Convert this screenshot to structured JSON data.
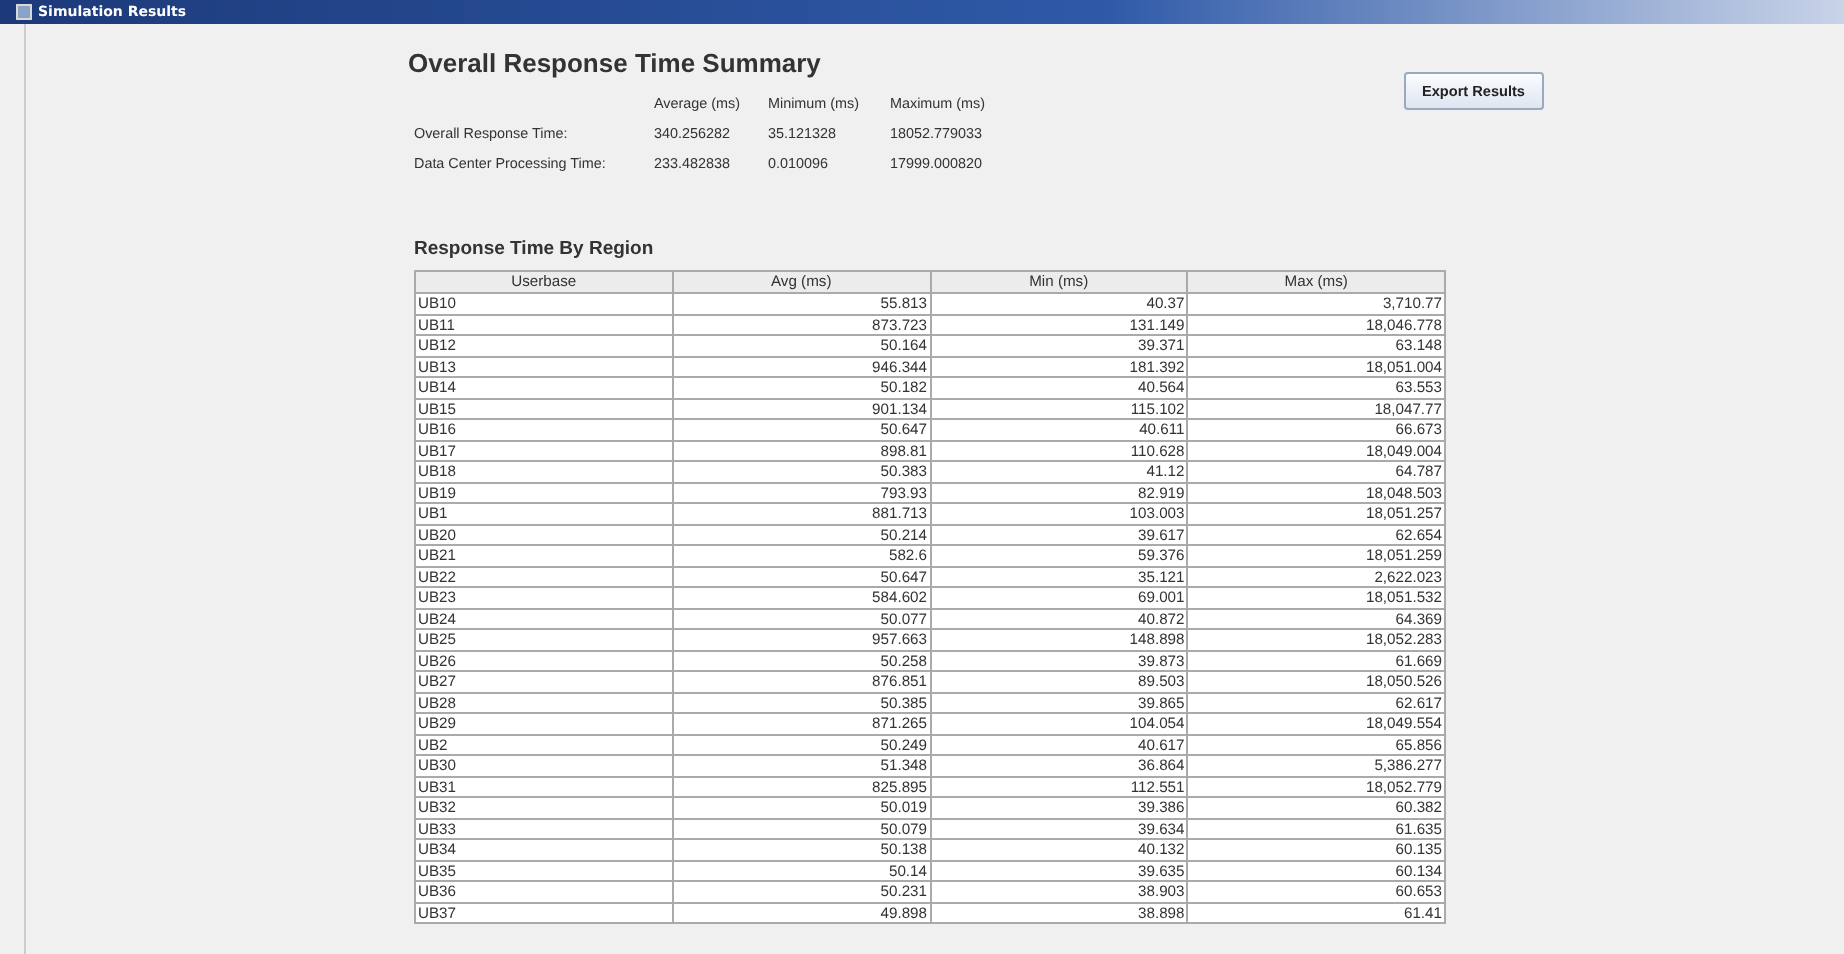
{
  "window": {
    "title": "Simulation Results"
  },
  "summary": {
    "title": "Overall Response Time Summary",
    "columns": [
      "Average (ms)",
      "Minimum (ms)",
      "Maximum (ms)"
    ],
    "rows": [
      {
        "label": "Overall Response Time:",
        "values": [
          "340.256282",
          "35.121328",
          "18052.779033"
        ]
      },
      {
        "label": "Data Center Processing Time:",
        "values": [
          "233.482838",
          "0.010096",
          "17999.000820"
        ]
      }
    ]
  },
  "export_button": "Export Results",
  "region": {
    "title": "Response Time By Region",
    "columns": [
      "Userbase",
      "Avg (ms)",
      "Min (ms)",
      "Max (ms)"
    ],
    "rows": [
      [
        "UB10",
        "55.813",
        "40.37",
        "3,710.77"
      ],
      [
        "UB11",
        "873.723",
        "131.149",
        "18,046.778"
      ],
      [
        "UB12",
        "50.164",
        "39.371",
        "63.148"
      ],
      [
        "UB13",
        "946.344",
        "181.392",
        "18,051.004"
      ],
      [
        "UB14",
        "50.182",
        "40.564",
        "63.553"
      ],
      [
        "UB15",
        "901.134",
        "115.102",
        "18,047.77"
      ],
      [
        "UB16",
        "50.647",
        "40.611",
        "66.673"
      ],
      [
        "UB17",
        "898.81",
        "110.628",
        "18,049.004"
      ],
      [
        "UB18",
        "50.383",
        "41.12",
        "64.787"
      ],
      [
        "UB19",
        "793.93",
        "82.919",
        "18,048.503"
      ],
      [
        "UB1",
        "881.713",
        "103.003",
        "18,051.257"
      ],
      [
        "UB20",
        "50.214",
        "39.617",
        "62.654"
      ],
      [
        "UB21",
        "582.6",
        "59.376",
        "18,051.259"
      ],
      [
        "UB22",
        "50.647",
        "35.121",
        "2,622.023"
      ],
      [
        "UB23",
        "584.602",
        "69.001",
        "18,051.532"
      ],
      [
        "UB24",
        "50.077",
        "40.872",
        "64.369"
      ],
      [
        "UB25",
        "957.663",
        "148.898",
        "18,052.283"
      ],
      [
        "UB26",
        "50.258",
        "39.873",
        "61.669"
      ],
      [
        "UB27",
        "876.851",
        "89.503",
        "18,050.526"
      ],
      [
        "UB28",
        "50.385",
        "39.865",
        "62.617"
      ],
      [
        "UB29",
        "871.265",
        "104.054",
        "18,049.554"
      ],
      [
        "UB2",
        "50.249",
        "40.617",
        "65.856"
      ],
      [
        "UB30",
        "51.348",
        "36.864",
        "5,386.277"
      ],
      [
        "UB31",
        "825.895",
        "112.551",
        "18,052.779"
      ],
      [
        "UB32",
        "50.019",
        "39.386",
        "60.382"
      ],
      [
        "UB33",
        "50.079",
        "39.634",
        "61.635"
      ],
      [
        "UB34",
        "50.138",
        "40.132",
        "60.135"
      ],
      [
        "UB35",
        "50.14",
        "39.635",
        "60.134"
      ],
      [
        "UB36",
        "50.231",
        "38.903",
        "60.653"
      ],
      [
        "UB37",
        "49.898",
        "38.898",
        "61.41"
      ]
    ]
  }
}
